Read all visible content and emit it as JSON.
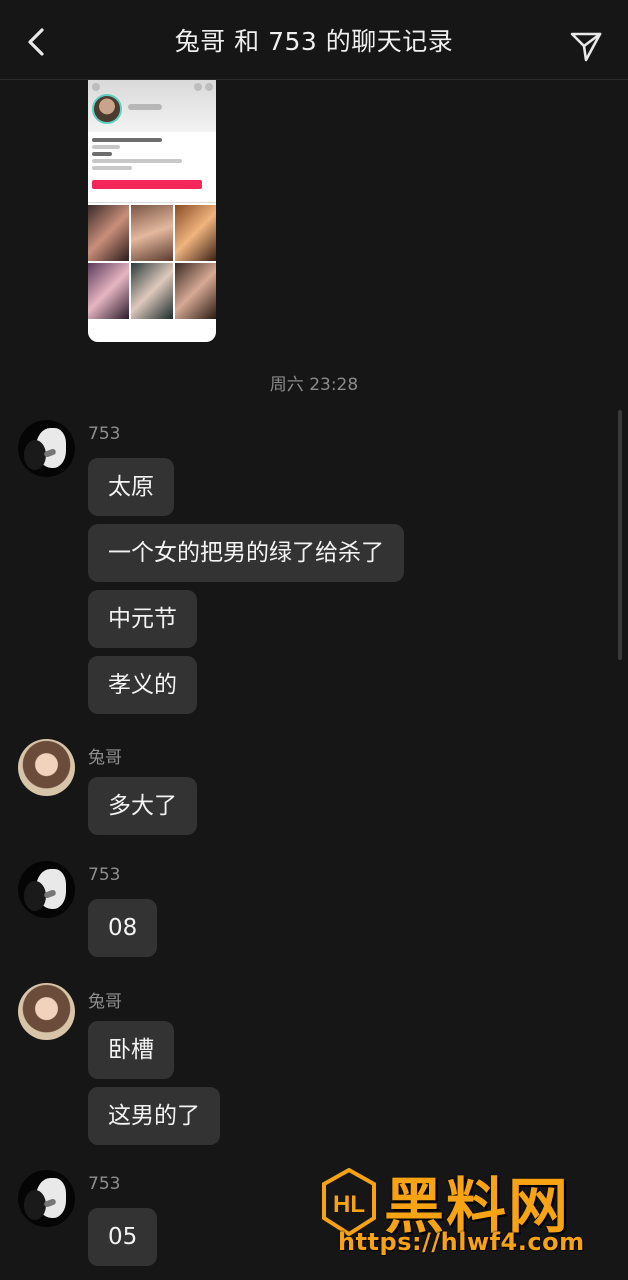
{
  "header": {
    "title": "兔哥 和 753 的聊天记录",
    "back_icon": "chevron-left-icon",
    "share_icon": "send-icon"
  },
  "time_separator": "周六 23:28",
  "groups": [
    {
      "sender": "753",
      "avatar": "avatar-753",
      "messages": [
        "太原",
        "一个女的把男的绿了给杀了",
        "中元节",
        "孝义的"
      ]
    },
    {
      "sender": "兔哥",
      "avatar": "avatar-tuge",
      "messages": [
        "多大了"
      ]
    },
    {
      "sender": "753",
      "avatar": "avatar-753",
      "messages": [
        "08"
      ]
    },
    {
      "sender": "兔哥",
      "avatar": "avatar-tuge",
      "messages": [
        "卧槽",
        "这男的了"
      ]
    },
    {
      "sender": "753",
      "avatar": "avatar-753",
      "messages": [
        "05"
      ]
    }
  ],
  "watermark": {
    "name": "黑料网",
    "url": "https://hlwf4.com",
    "color": "#f7a313"
  },
  "colors": {
    "background": "#161616",
    "bubble": "#333333",
    "accent_follow": "#f5265a"
  }
}
